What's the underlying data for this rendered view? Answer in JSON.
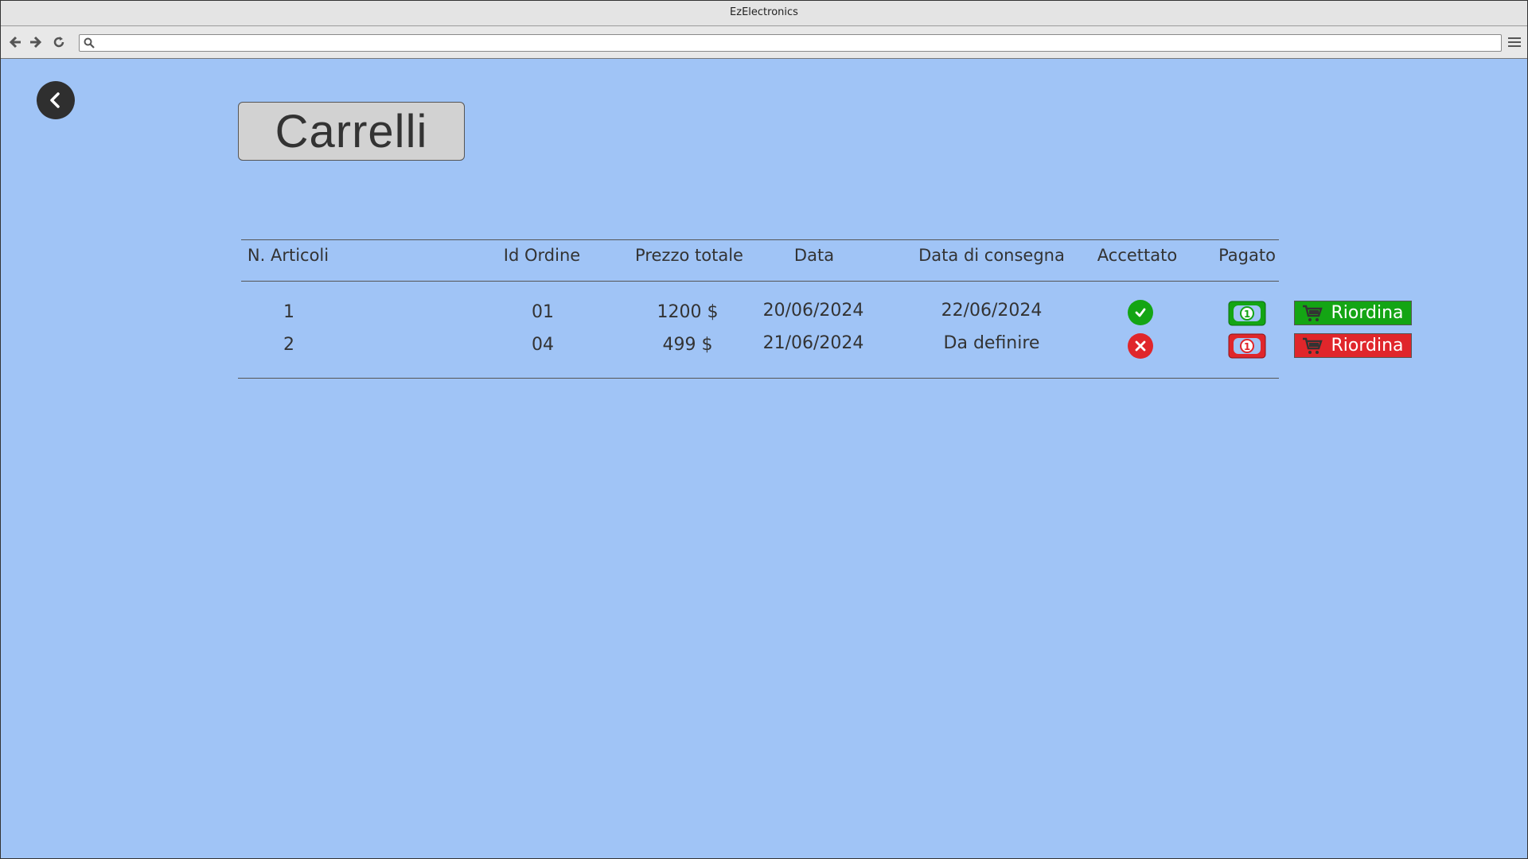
{
  "window": {
    "title": "EzElectronics"
  },
  "page": {
    "title": "Carrelli"
  },
  "table": {
    "headers": [
      "N. Articoli",
      "Id Ordine",
      "Prezzo totale",
      "Data",
      "Data di consegna",
      "Accettato",
      "Pagato"
    ],
    "rows": [
      {
        "articoli": "1",
        "id_ordine": "01",
        "prezzo": "1200 $",
        "data": "20/06/2024",
        "consegna": "22/06/2024",
        "accettato": "check-icon",
        "pagato": "paid",
        "action": "Riordina",
        "status_color": "#14a514"
      },
      {
        "articoli": "2",
        "id_ordine": "04",
        "prezzo": "499 $",
        "data": "21/06/2024",
        "consegna": "Da definire",
        "accettato": "cross-icon",
        "pagato": "unpaid",
        "action": "Riordina",
        "status_color": "#e0262b"
      }
    ]
  },
  "colors": {
    "background": "#a0c4f6",
    "green": "#14a514",
    "red": "#e0262b"
  }
}
